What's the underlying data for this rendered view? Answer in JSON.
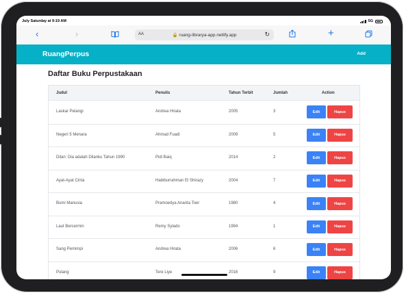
{
  "status_bar": {
    "time": "July Saturday at 9:19 AM",
    "network": "5G"
  },
  "browser": {
    "text_size_label": "AA",
    "url": "ruang-libraryа-app.netlify.app",
    "icons": {
      "back": "chevron-left-icon",
      "forward": "chevron-right-icon",
      "bookmarks": "book-icon",
      "lock": "lock-icon",
      "reload": "reload-icon",
      "share": "share-icon",
      "new_tab": "plus-icon",
      "tabs": "tabs-icon"
    }
  },
  "navbar": {
    "brand": "RuangPerpus",
    "add_label": "Add"
  },
  "page": {
    "title": "Daftar Buku Perpustakaan"
  },
  "table": {
    "headers": [
      "Judul",
      "Penulis",
      "Tahun Terbit",
      "Jumlah",
      "Action"
    ],
    "edit_label": "Edit",
    "delete_label": "Hapus",
    "rows": [
      [
        "Laskar Pelangi",
        "Andrea Hirata",
        "2005",
        "3"
      ],
      [
        "Negeri 5 Menara",
        "Ahmad Fuadi",
        "2009",
        "5"
      ],
      [
        "Dilan: Dia adalah Dilanku Tahun 1990",
        "Pidi Baiq",
        "2014",
        "2"
      ],
      [
        "Ayat-Ayat Cinta",
        "Habiburrahman El Shirazy",
        "2004",
        "7"
      ],
      [
        "Bumi Manusia",
        "Pramoedya Ananta Toer",
        "1980",
        "4"
      ],
      [
        "Laut Bercermin",
        "Remy Sylado",
        "1994",
        "1"
      ],
      [
        "Sang Pemimpi",
        "Andrea Hirata",
        "2006",
        "6"
      ],
      [
        "Pulang",
        "Tere Liye",
        "2016",
        "9"
      ]
    ]
  },
  "colors": {
    "navbar": "#06b0c7",
    "edit": "#3b82f6",
    "delete": "#ef4444"
  }
}
